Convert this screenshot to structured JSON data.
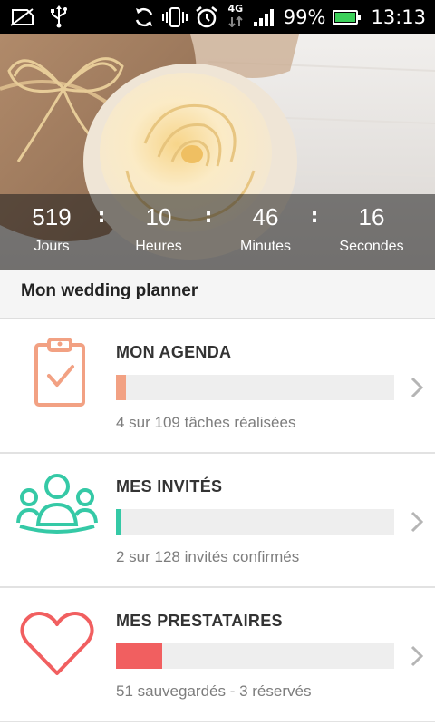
{
  "status_bar": {
    "battery_percent": "99%",
    "network_label": "4G",
    "time": "13:13",
    "icons": [
      "no-sim-icon",
      "usb-icon",
      "sync-icon",
      "vibrate-icon",
      "alarm-icon",
      "network-4g-icon",
      "signal-icon",
      "battery-icon"
    ],
    "battery_level": 0.99
  },
  "hero": {
    "image": "rose-and-gift-photo",
    "countdown": [
      {
        "value": "519",
        "label": "Jours"
      },
      {
        "value": "10",
        "label": "Heures"
      },
      {
        "value": "46",
        "label": "Minutes"
      },
      {
        "value": "16",
        "label": "Secondes"
      }
    ],
    "separator": ":"
  },
  "planner": {
    "title": "Mon wedding planner",
    "cards": [
      {
        "title": "MON AGENDA",
        "status": "4 sur 109 tâches réalisées",
        "progress": 0.037,
        "color": "#f2a183",
        "icon": "clipboard-check-icon"
      },
      {
        "title": "MES INVITÉS",
        "status": "2 sur 128 invités confirmés",
        "progress": 0.016,
        "color": "#35c9a6",
        "icon": "guests-icon"
      },
      {
        "title": "MES PRESTATAIRES",
        "status": "51 sauvegardés - 3 réservés",
        "progress": 0.166,
        "color": "#f15f60",
        "icon": "heart-icon"
      }
    ]
  },
  "colors": {
    "accent_agenda": "#f2a183",
    "accent_guests": "#35c9a6",
    "accent_vendors": "#f15f60",
    "track": "#eeeeee"
  }
}
